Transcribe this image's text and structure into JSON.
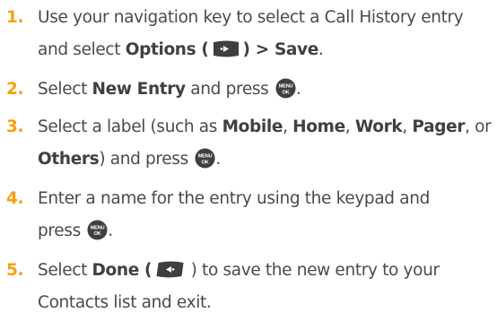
{
  "colors": {
    "step_number": "#f5a012",
    "text": "#4a4a4a",
    "icon": "#3f3f3f"
  },
  "steps": [
    {
      "number": "1.",
      "l1_text": "Use your navigation key to select a Call History entry",
      "l2_pre": "and select ",
      "l2_b1": "Options",
      "l2_mid": " (",
      "l2_post1": ") ",
      "l2_b2": "> Save",
      "l2_end": "."
    },
    {
      "number": "2.",
      "pre": "Select ",
      "b1": "New Entry",
      "post": " and press ",
      "end": "."
    },
    {
      "number": "3.",
      "pre": "Select a label (such as ",
      "b1": "Mobile",
      "sep1": ", ",
      "b2": "Home",
      "sep2": ", ",
      "b3": "Work",
      "sep3": ", ",
      "b4": "Pager",
      "sep4": ", or",
      "l2_b": "Others",
      "l2_post": ") and press ",
      "l2_end": "."
    },
    {
      "number": "4.",
      "l1_text": "Enter a name for the entry using the keypad and",
      "l2_pre": "press ",
      "l2_end": "."
    },
    {
      "number": "5.",
      "pre": "Select ",
      "b1": "Done",
      "mid": " (",
      "post": " ) to save the new entry to your",
      "l2_text": "Contacts list and exit."
    }
  ],
  "key_labels": {
    "menu": "MENU",
    "ok": "OK"
  },
  "icons": {
    "options_softkey": "right-softkey-icon",
    "menu_ok_key": "menu-ok-key-icon",
    "done_softkey": "left-softkey-icon"
  }
}
